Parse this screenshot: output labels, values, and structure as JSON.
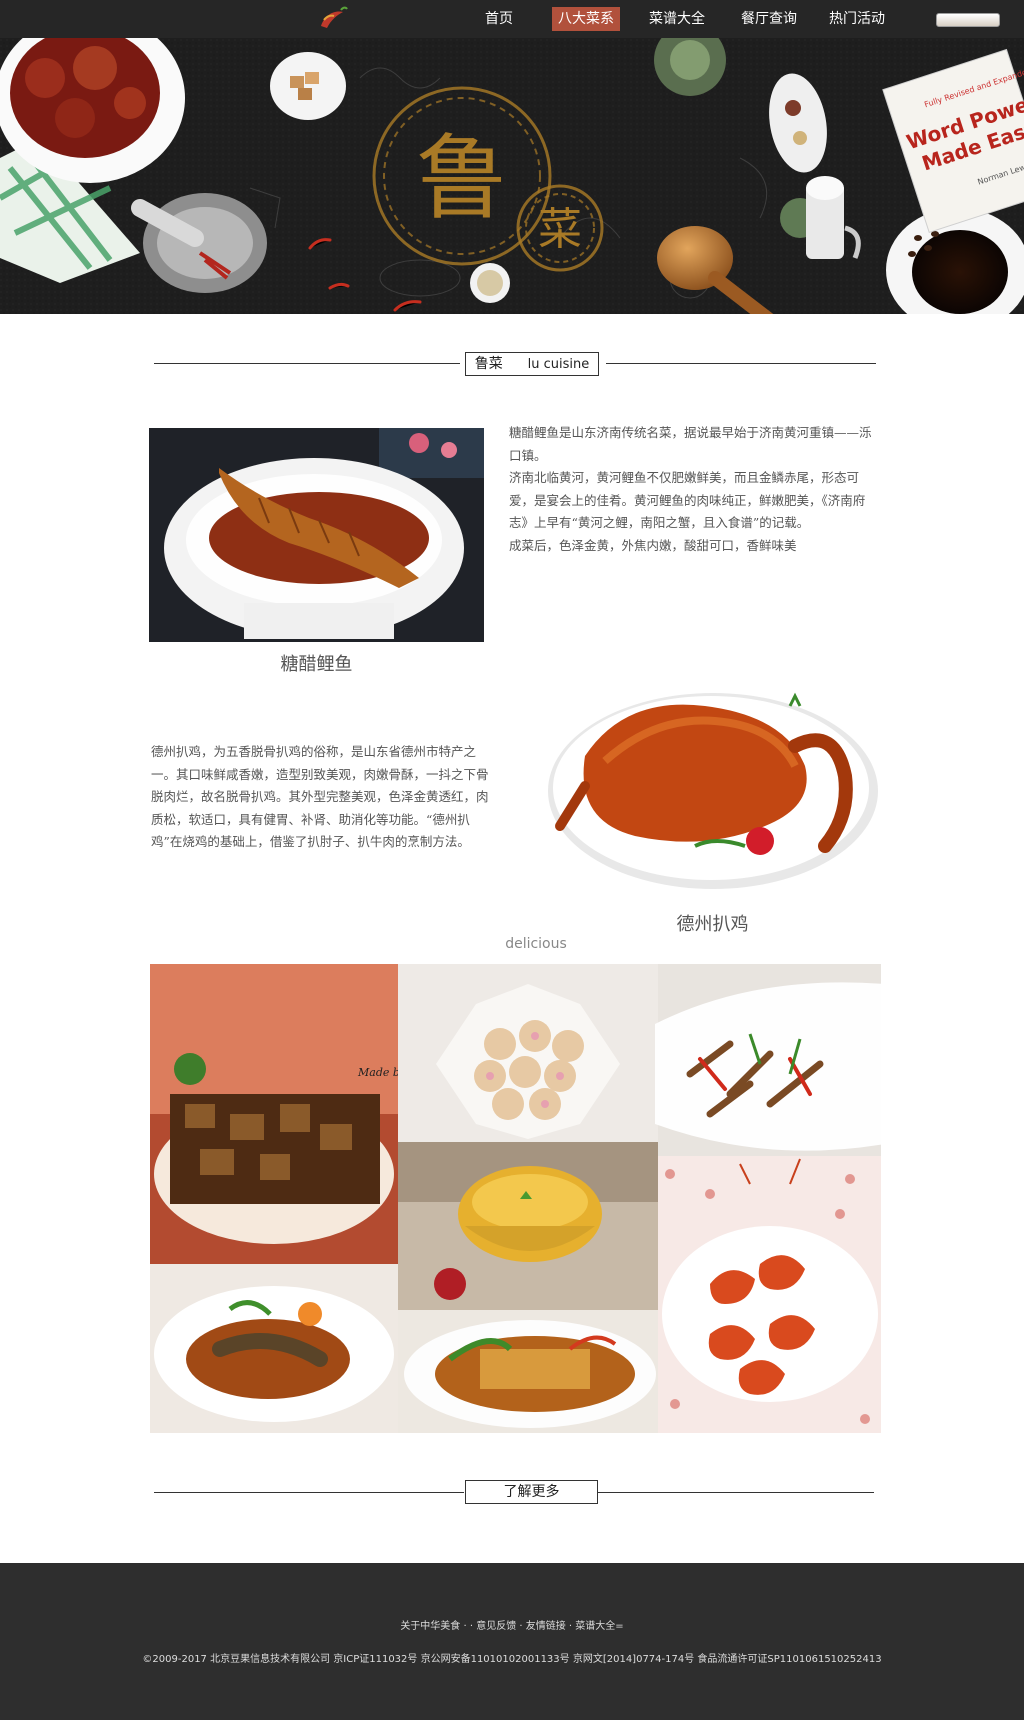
{
  "header": {
    "logo": "chili-logo-icon",
    "nav": [
      {
        "label": "首页",
        "active": false
      },
      {
        "label": "八大菜系",
        "active": true
      },
      {
        "label": "菜谱大全",
        "active": false
      },
      {
        "label": "餐厅查询",
        "active": false
      },
      {
        "label": "热门活动",
        "active": false
      }
    ]
  },
  "hero": {
    "big_char": "鲁",
    "small_char": "菜",
    "book_lines": [
      "Word Power",
      "Made Easy"
    ],
    "book_banner": "Fully Revised and Expanded",
    "book_author": "Norman Lewis"
  },
  "section": {
    "title_cn": "鲁菜",
    "title_en": "lu cuisine"
  },
  "dishes": [
    {
      "name": "糖醋鲤鱼",
      "paragraphs": [
        "糖醋鲤鱼是山东济南传统名菜，据说最早始于济南黄河重镇——泺口镇。",
        "济南北临黄河，黄河鲤鱼不仅肥嫩鲜美，而且金鳞赤尾，形态可爱，是宴会上的佳肴。黄河鲤鱼的肉味纯正，鲜嫩肥美，《济南府志》上早有“黄河之鲤，南阳之蟹，且入食谱”的记载。",
        "成菜后，色泽金黄，外焦内嫩，酸甜可口，香鲜味美"
      ]
    },
    {
      "name": "德州扒鸡",
      "paragraphs": [
        "德州扒鸡，为五香脱骨扒鸡的俗称，是山东省德州市特产之一。其口味鲜咸香嫩，造型别致美观，肉嫩骨酥，一抖之下骨脱肉烂，故名脱骨扒鸡。其外型完整美观，色泽金黄透红，肉质松，软适口，具有健胃、补肾、助消化等功能。“德州扒鸡”在烧鸡的基础上，借鉴了扒肘子、扒牛肉的烹制方法。"
      ]
    }
  ],
  "gallery": {
    "label": "delicious",
    "watermark": "Made by Fly"
  },
  "more": {
    "label": "了解更多"
  },
  "footer": {
    "links": "关于中华美食 · · 意见反馈 · 友情链接 · 菜谱大全=",
    "copyright": "©2009-2017 北京豆果信息技术有限公司 京ICP证111032号 京公网安备11010102001133号 京网文[2014]0774-174号 食品流通许可证SP1101061510252413"
  },
  "colors": {
    "nav_bg": "#262626",
    "nav_active": "#b1513c",
    "hero_bg": "#1d1d1d",
    "hero_gold": "#a97a26",
    "footer_bg": "#2e2e2e"
  }
}
